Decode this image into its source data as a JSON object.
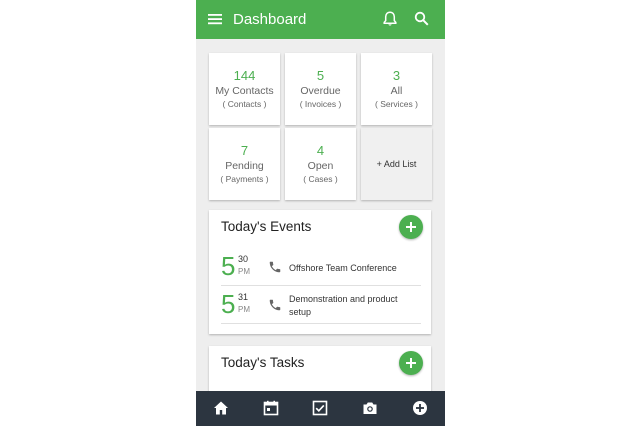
{
  "appbar": {
    "title": "Dashboard",
    "icons": [
      "menu-icon",
      "bell-icon",
      "search-icon"
    ],
    "color": "#4caf50"
  },
  "tiles": [
    {
      "number": "144",
      "label": "My Contacts",
      "sub": "( Contacts )"
    },
    {
      "number": "5",
      "label": "Overdue",
      "sub": "( Invoices )"
    },
    {
      "number": "3",
      "label": "All",
      "sub": "( Services )"
    },
    {
      "number": "7",
      "label": "Pending",
      "sub": "( Payments )"
    },
    {
      "number": "4",
      "label": "Open",
      "sub": "( Cases )"
    }
  ],
  "add_list": {
    "label": "+ Add List"
  },
  "events_card": {
    "title": "Today's Events",
    "events": [
      {
        "day": "5",
        "minute": "30",
        "ampm": "PM",
        "name": "Offshore Team Conference"
      },
      {
        "day": "5",
        "minute": "31",
        "ampm": "PM",
        "name": "Demonstration and product setup"
      }
    ]
  },
  "tasks_card": {
    "title": "Today's Tasks"
  },
  "bottom_nav": [
    "home-icon",
    "calendar-icon",
    "checkbox-icon",
    "camera-icon",
    "add-circle-icon"
  ],
  "colors": {
    "accent": "#4caf50",
    "bottom_bar": "#2c3540"
  }
}
